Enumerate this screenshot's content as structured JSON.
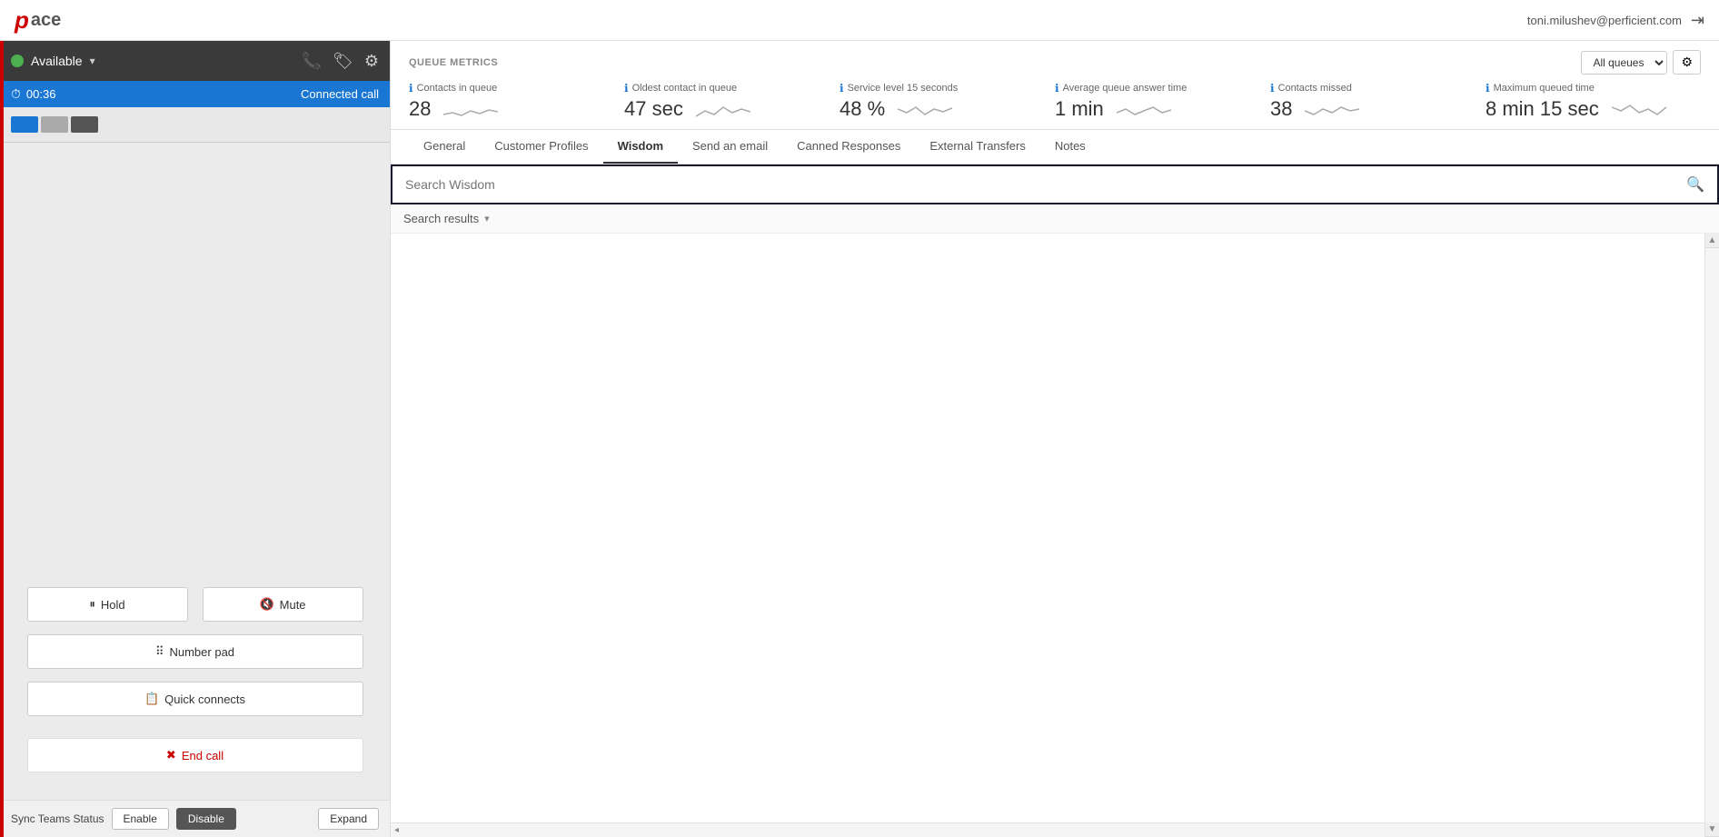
{
  "header": {
    "logo_accent": "p",
    "logo_text": "ace",
    "user_email": "toni.milushev@perficient.com",
    "logout_icon": "→"
  },
  "left_panel": {
    "status": {
      "label": "Available",
      "arrow": "▾",
      "phone_icon": "📞",
      "chat_icon": "💬",
      "settings_icon": "⚙"
    },
    "call_info": {
      "timer_icon": "⏱",
      "time": "00:36",
      "status": "Connected call"
    },
    "buttons": {
      "hold": "Hold",
      "mute": "Mute",
      "number_pad": "Number pad",
      "quick_connects": "Quick connects",
      "end_call": "End call"
    },
    "bottom": {
      "sync_label": "Sync Teams Status",
      "enable": "Enable",
      "disable": "Disable",
      "expand": "Expand"
    }
  },
  "queue_metrics": {
    "title": "QUEUE METRICS",
    "queue_selector": {
      "label": "All queues",
      "settings_icon": "⚙"
    },
    "metrics": [
      {
        "label": "Contacts in queue",
        "value": "28"
      },
      {
        "label": "Oldest contact in queue",
        "value": "47 sec"
      },
      {
        "label": "Service level 15 seconds",
        "value": "48 %"
      },
      {
        "label": "Average queue answer time",
        "value": "1 min"
      },
      {
        "label": "Contacts missed",
        "value": "38"
      },
      {
        "label": "Maximum queued time",
        "value": "8 min 15 sec"
      }
    ]
  },
  "tabs": {
    "items": [
      {
        "label": "General",
        "active": false
      },
      {
        "label": "Customer Profiles",
        "active": false
      },
      {
        "label": "Wisdom",
        "active": true
      },
      {
        "label": "Send an email",
        "active": false
      },
      {
        "label": "Canned Responses",
        "active": false
      },
      {
        "label": "External Transfers",
        "active": false
      },
      {
        "label": "Notes",
        "active": false
      }
    ]
  },
  "wisdom": {
    "search_placeholder": "Search Wisdom",
    "search_icon": "🔍",
    "results_label": "Search results",
    "collapse_icon": "▾",
    "left_arrow": "◂",
    "up_arrow": "▲",
    "down_arrow": "▼"
  }
}
